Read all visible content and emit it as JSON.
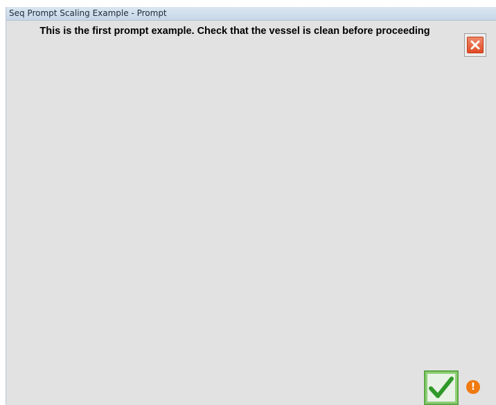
{
  "window": {
    "title": "Seq Prompt Scaling Example - Prompt"
  },
  "prompt": {
    "message": "This is the first prompt example. Check that the vessel is clean before proceeding"
  },
  "icons": {
    "close": "close-icon",
    "confirm": "checkmark-icon",
    "warning": "warning-icon"
  },
  "colors": {
    "close_red": "#e04a24",
    "confirm_green": "#2f9a2a",
    "warning_orange": "#f07a10",
    "background": "#e2e2e2"
  }
}
